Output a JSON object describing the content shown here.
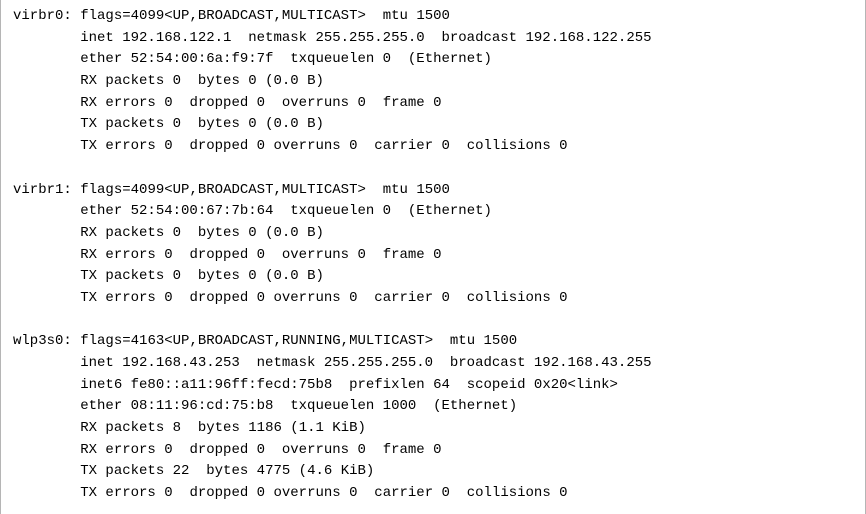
{
  "interfaces": [
    {
      "name": "virbr0",
      "flags_value": "4099",
      "flags_list": "UP,BROADCAST,MULTICAST",
      "mtu": "1500",
      "inet": {
        "addr": "192.168.122.1",
        "netmask": "255.255.255.0",
        "broadcast": "192.168.122.255"
      },
      "ether": {
        "mac": "52:54:00:6a:f9:7f",
        "txqueuelen": "0",
        "type": "Ethernet"
      },
      "rx_packets": {
        "packets": "0",
        "bytes": "0",
        "human": "0.0 B"
      },
      "rx_errors": {
        "errors": "0",
        "dropped": "0",
        "overruns": "0",
        "frame": "0"
      },
      "tx_packets": {
        "packets": "0",
        "bytes": "0",
        "human": "0.0 B"
      },
      "tx_errors": {
        "errors": "0",
        "dropped": "0",
        "overruns": "0",
        "carrier": "0",
        "collisions": "0"
      }
    },
    {
      "name": "virbr1",
      "flags_value": "4099",
      "flags_list": "UP,BROADCAST,MULTICAST",
      "mtu": "1500",
      "ether": {
        "mac": "52:54:00:67:7b:64",
        "txqueuelen": "0",
        "type": "Ethernet"
      },
      "rx_packets": {
        "packets": "0",
        "bytes": "0",
        "human": "0.0 B"
      },
      "rx_errors": {
        "errors": "0",
        "dropped": "0",
        "overruns": "0",
        "frame": "0"
      },
      "tx_packets": {
        "packets": "0",
        "bytes": "0",
        "human": "0.0 B"
      },
      "tx_errors": {
        "errors": "0",
        "dropped": "0",
        "overruns": "0",
        "carrier": "0",
        "collisions": "0"
      }
    },
    {
      "name": "wlp3s0",
      "flags_value": "4163",
      "flags_list": "UP,BROADCAST,RUNNING,MULTICAST",
      "mtu": "1500",
      "inet": {
        "addr": "192.168.43.253",
        "netmask": "255.255.255.0",
        "broadcast": "192.168.43.255"
      },
      "inet6": {
        "addr": "fe80::a11:96ff:fecd:75b8",
        "prefixlen": "64",
        "scopeid": "0x20<link>"
      },
      "ether": {
        "mac": "08:11:96:cd:75:b8",
        "txqueuelen": "1000",
        "type": "Ethernet"
      },
      "rx_packets": {
        "packets": "8",
        "bytes": "1186",
        "human": "1.1 KiB"
      },
      "rx_errors": {
        "errors": "0",
        "dropped": "0",
        "overruns": "0",
        "frame": "0"
      },
      "tx_packets": {
        "packets": "22",
        "bytes": "4775",
        "human": "4.6 KiB"
      },
      "tx_errors": {
        "errors": "0",
        "dropped": "0",
        "overruns": "0",
        "carrier": "0",
        "collisions": "0"
      }
    }
  ]
}
